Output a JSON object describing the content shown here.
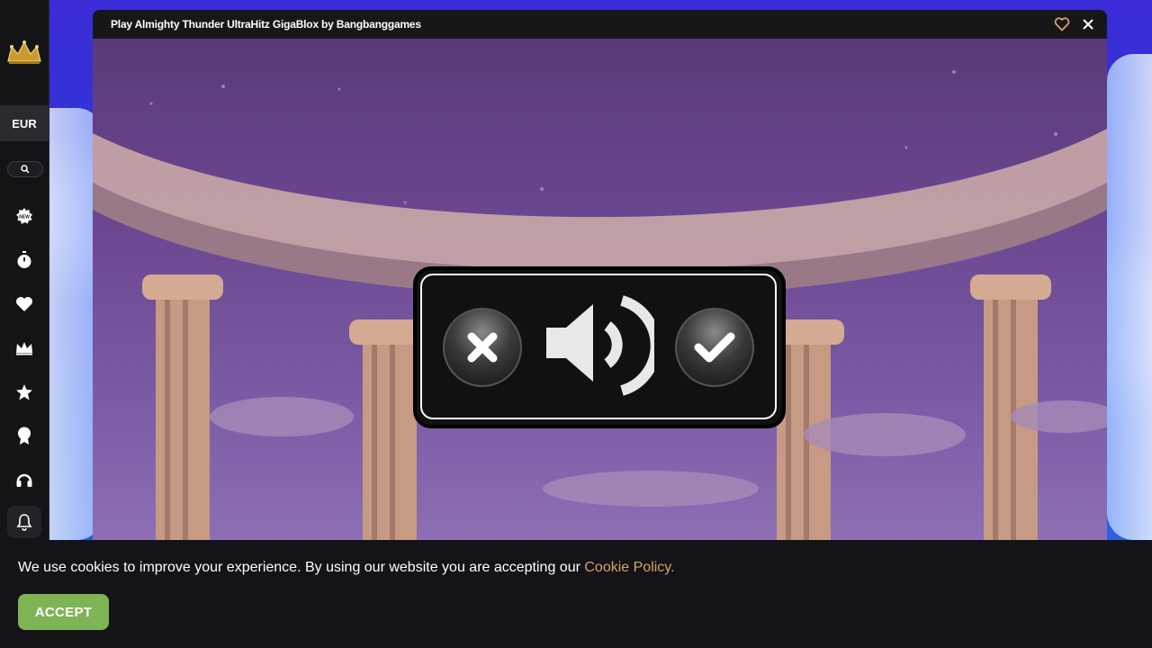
{
  "game": {
    "title": "Play Almighty Thunder UltraHitz GigaBlox by Bangbanggames",
    "favorite_icon": "heart-outline-icon",
    "close_icon": "close-icon",
    "sound_prompt": {
      "decline_icon": "x-icon",
      "speaker_icon": "speaker-volume-icon",
      "confirm_icon": "checkmark-icon"
    }
  },
  "sidebar": {
    "logo_icon": "crown-logo-icon",
    "currency": "EUR",
    "search_icon": "search-icon",
    "items": [
      {
        "icon": "new-badge-icon"
      },
      {
        "icon": "stopwatch-icon"
      },
      {
        "icon": "heart-icon"
      },
      {
        "icon": "crown-icon"
      },
      {
        "icon": "star-icon"
      },
      {
        "icon": "award-ribbon-icon"
      },
      {
        "icon": "headset-icon"
      },
      {
        "icon": "bell-icon"
      }
    ]
  },
  "cookie": {
    "text": "We use cookies to improve your experience. By using our website you are accepting our ",
    "link_text": "Cookie Policy.",
    "accept_label": "ACCEPT"
  },
  "colors": {
    "accent_gold": "#d9a36a",
    "accept_green": "#7fb456"
  }
}
